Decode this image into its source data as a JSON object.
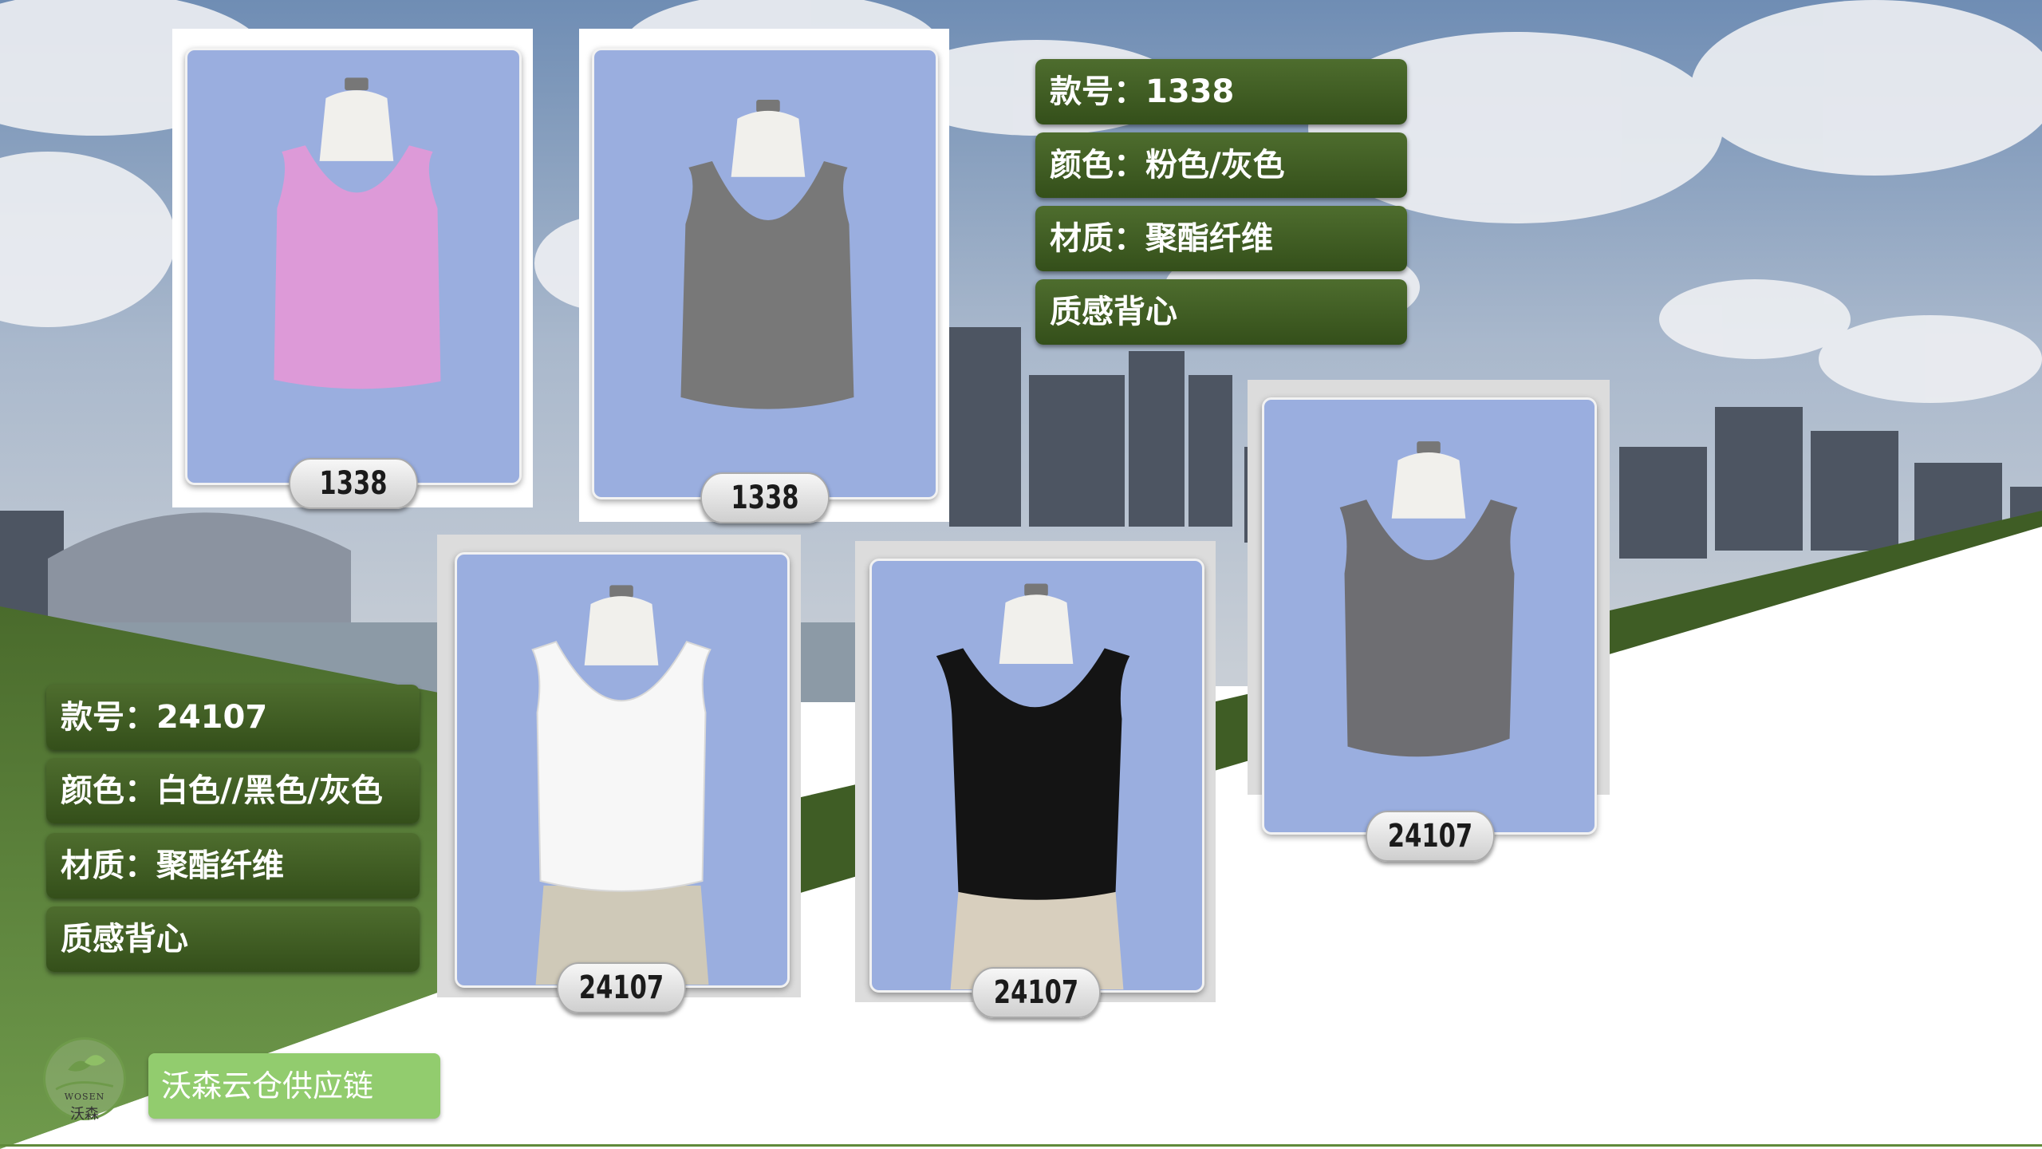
{
  "palette": {
    "sky": "#7d95b6",
    "green_dark": "#3d5a22",
    "green_mid": "#5f8a3a",
    "green_light": "#92cc6e",
    "card_bg": "#9aaedf",
    "white": "#ffffff"
  },
  "product_1338": {
    "style_no": "款号：1338",
    "color": "颜色：粉色/灰色",
    "material": "材质：聚酯纤维",
    "description": "质感背心"
  },
  "product_24107": {
    "style_no": "款号：24107",
    "color": "颜色：白色//黑色/灰色",
    "material": "材质：聚酯纤维",
    "description": "质感背心"
  },
  "cards": [
    {
      "tag": "1338",
      "garment_color": "#dd9ad8",
      "garment": "pink tank top"
    },
    {
      "tag": "1338",
      "garment_color": "#787878",
      "garment": "gray tank top"
    },
    {
      "tag": "24107",
      "garment_color": "#f7f7f7",
      "garment": "white tank top"
    },
    {
      "tag": "24107",
      "garment_color": "#141414",
      "garment": "black tank top"
    },
    {
      "tag": "24107",
      "garment_color": "#6e6e72",
      "garment": "gray tank top"
    }
  ],
  "brand": {
    "logo_en": "WOSEN",
    "logo_cn": "沃森",
    "name": "沃森云仓供应链"
  }
}
